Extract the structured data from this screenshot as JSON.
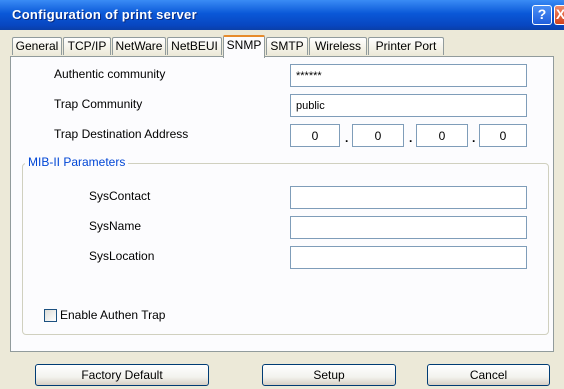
{
  "window": {
    "title": "Configuration of print server",
    "help_label": "?",
    "close_label": "X"
  },
  "tabs": [
    {
      "label": "General"
    },
    {
      "label": "TCP/IP"
    },
    {
      "label": "NetWare"
    },
    {
      "label": "NetBEUI"
    },
    {
      "label": "SNMP"
    },
    {
      "label": "SMTP"
    },
    {
      "label": "Wireless"
    },
    {
      "label": "Printer Port"
    }
  ],
  "snmp": {
    "authentic_community": {
      "label": "Authentic community",
      "value": "******"
    },
    "trap_community": {
      "label": "Trap Community",
      "value": "public"
    },
    "trap_destination": {
      "label": "Trap Destination Address",
      "octets": [
        "0",
        "0",
        "0",
        "0"
      ],
      "separator": "."
    },
    "mib": {
      "title": "MIB-II Parameters",
      "sys_contact": {
        "label": "SysContact",
        "value": ""
      },
      "sys_name": {
        "label": "SysName",
        "value": ""
      },
      "sys_location": {
        "label": "SysLocation",
        "value": ""
      }
    },
    "enable_authen_trap": {
      "label": "Enable Authen Trap",
      "checked": false
    }
  },
  "buttons": {
    "factory_default": "Factory Default",
    "setup": "Setup",
    "cancel": "Cancel"
  }
}
